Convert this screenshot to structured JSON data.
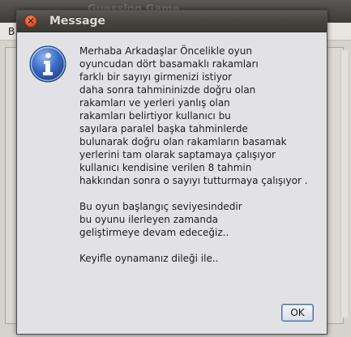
{
  "background_window": {
    "title": "Guessing Game",
    "menu_first_letter": "B"
  },
  "dialog": {
    "title": "Message",
    "icon": "info-icon",
    "message_lines": [
      "Merhaba Arkadaşlar Öncelikle oyun",
      "oyuncudan dört basamaklı rakamları",
      "farklı bir sayıyı girmenizi istiyor",
      "daha sonra tahmininizde doğru olan",
      "rakamları ve yerleri yanlış olan",
      "rakamları belirtiyor kullanıcı bu",
      "sayılara paralel başka tahminlerde",
      "bulunarak doğru olan rakamların basamak",
      "yerlerini tam olarak saptamaya çalışıyor",
      "kullanıcı kendisine verilen 8 tahmin",
      "hakkından sonra o sayıyı tutturmaya çalışıyor .",
      "",
      "Bu oyun başlangıç seviyesindedir",
      "bu oyunu ilerleyen zamanda",
      "geliştirmeye devam edeceğiz..",
      "",
      "Keyifle oynamanız dileği ile.."
    ],
    "ok_label": "OK",
    "close_glyph": "×"
  },
  "colors": {
    "dialog_bg": "#e2e2e6",
    "titlebar": "#45443f",
    "close_button": "#e0582a",
    "info_icon": "#3a6cc8"
  }
}
